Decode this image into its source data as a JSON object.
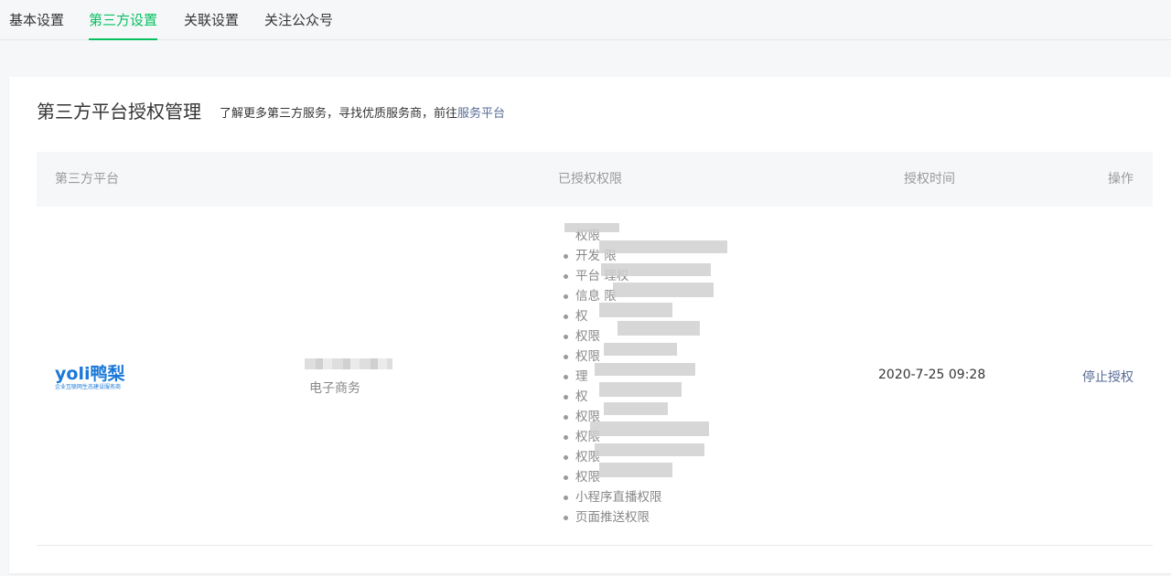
{
  "tabs": [
    {
      "label": "基本设置",
      "active": false
    },
    {
      "label": "第三方设置",
      "active": true
    },
    {
      "label": "关联设置",
      "active": false
    },
    {
      "label": "关注公众号",
      "active": false
    }
  ],
  "section": {
    "title": "第三方平台授权管理",
    "desc_prefix": "了解更多第三方服务，寻找优质服务商，前往",
    "desc_link": "服务平台"
  },
  "table": {
    "headers": {
      "platform": "第三方平台",
      "permissions": "已授权权限",
      "time": "授权时间",
      "action": "操作"
    },
    "rows": [
      {
        "logo_text": "yoli鸭梨",
        "logo_sub": "企业互联网生态建设服务商",
        "category": "电子商务",
        "permissions": [
          "权限",
          "开发 限",
          "平台 理权",
          "信息 限",
          "权",
          "权限",
          "权限",
          "理",
          "权",
          "权限",
          "权限",
          "权限",
          "权限",
          "小程序直播权限",
          "页面推送权限"
        ],
        "time": "2020-7-25 09:28",
        "action": "停止授权"
      }
    ]
  },
  "colors": {
    "accent": "#07c160",
    "link": "#576b95",
    "logo": "#1a78d8"
  }
}
